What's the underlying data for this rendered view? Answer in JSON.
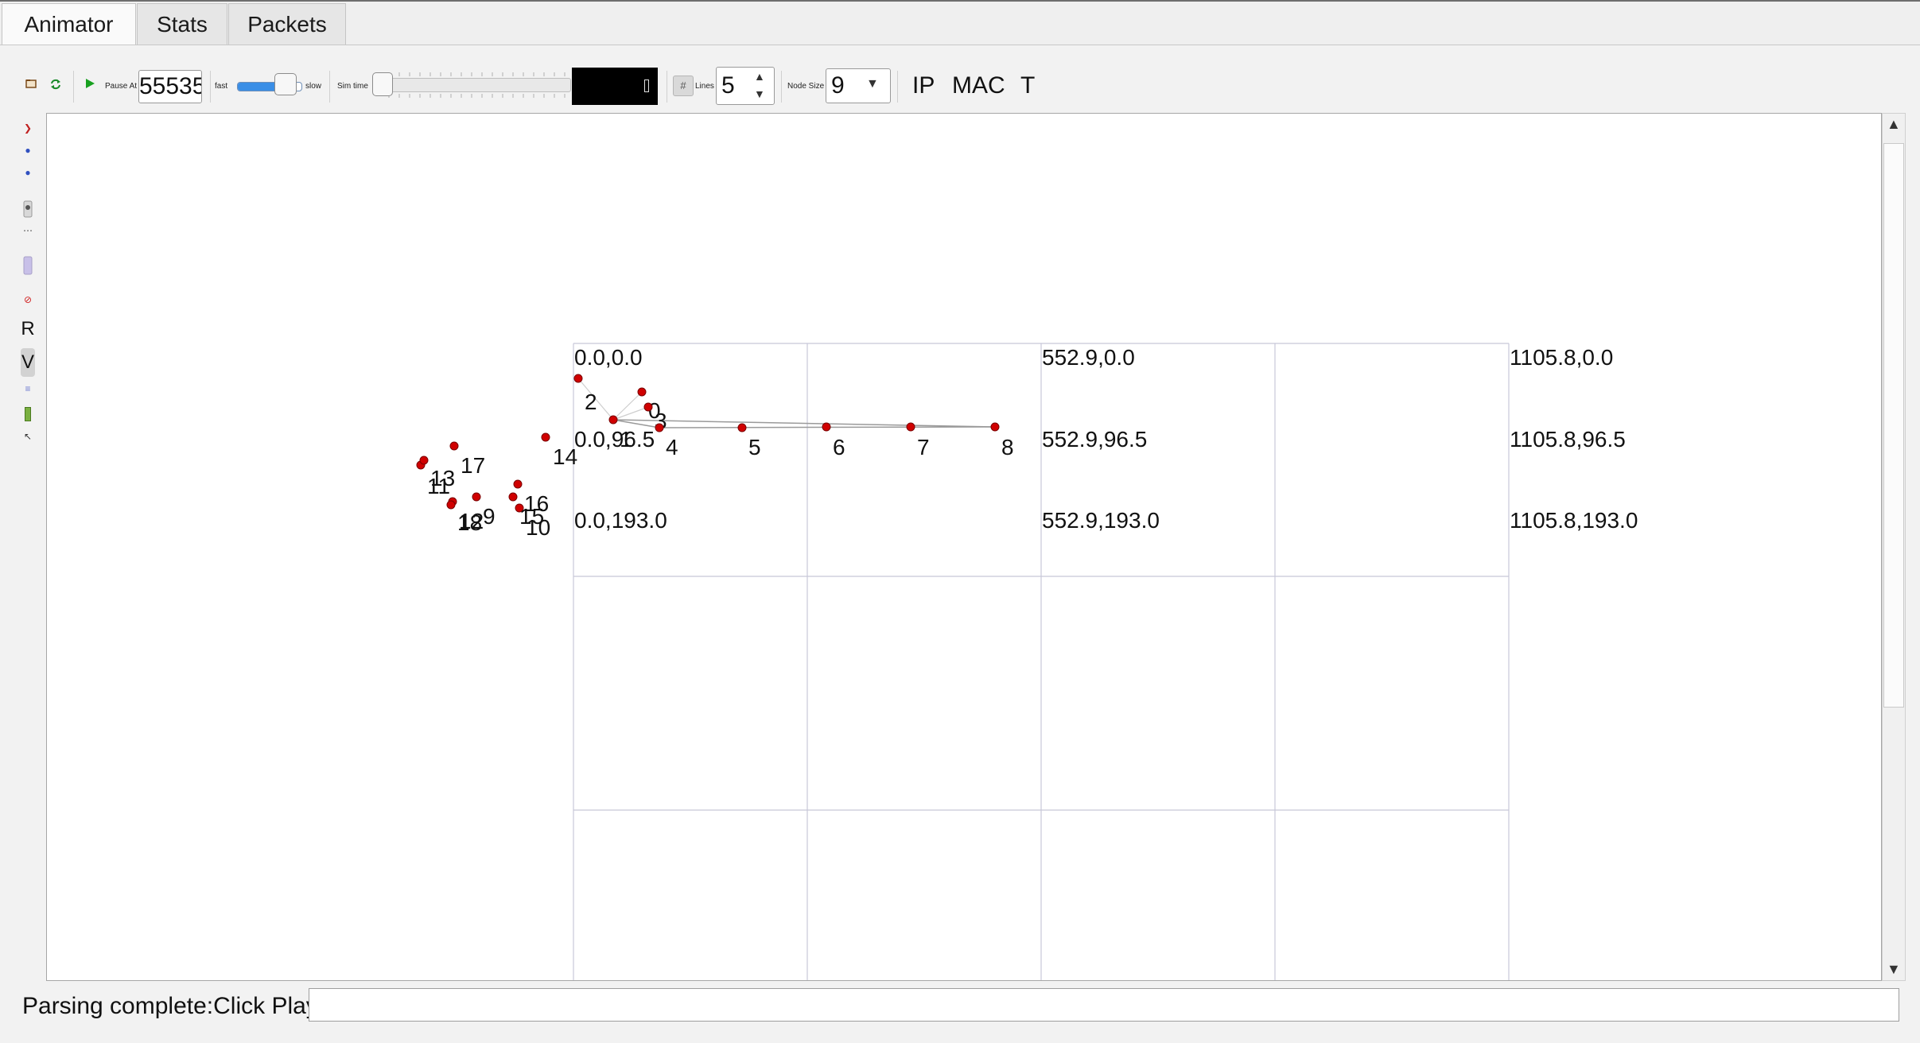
{
  "tabs": [
    {
      "label": "Animator",
      "active": true
    },
    {
      "label": "Stats",
      "active": false
    },
    {
      "label": "Packets",
      "active": false
    }
  ],
  "toolbar": {
    "open_icon": "folder-open-icon",
    "reload_icon": "reload-icon",
    "play_icon": "play-icon",
    "pause_at_label": "Pause At",
    "pause_at_value": "55535",
    "fast_label": "fast",
    "slow_label": "slow",
    "speed_level": 0.6,
    "sim_time_label": "Sim time",
    "sim_time_level": 0.0,
    "grid_icon": "grid-icon",
    "lines_label": "Lines",
    "lines_value": "5",
    "node_size_label": "Node Size",
    "node_size_value": "9",
    "ip_toggle": "IP",
    "mac_toggle": "MAC",
    "t_toggle": "T"
  },
  "left_toolbar": {
    "icons": [
      "arrow-right-icon",
      "zoom-in-icon",
      "zoom-out-icon",
      "node-icon",
      "link-icon",
      "snapshot-icon",
      "no-entry-icon",
      "r-button",
      "v-button",
      "list-icon",
      "battery-icon",
      "cursor-icon"
    ],
    "r_label": "R",
    "v_label": "V"
  },
  "canvas": {
    "grid_labels": [
      "0.0,0.0",
      "552.9,0.0",
      "1105.8,0.0",
      "0.0,96.5",
      "552.9,96.5",
      "1105.8,96.5",
      "0.0,193.0",
      "552.9,193.0",
      "1105.8,193.0"
    ],
    "node_color": "#d00000",
    "nodes": [
      {
        "id": "0"
      },
      {
        "id": "1"
      },
      {
        "id": "2"
      },
      {
        "id": "3"
      },
      {
        "id": "4"
      },
      {
        "id": "5"
      },
      {
        "id": "6"
      },
      {
        "id": "7"
      },
      {
        "id": "8"
      },
      {
        "id": "9"
      },
      {
        "id": "10"
      },
      {
        "id": "11"
      },
      {
        "id": "12"
      },
      {
        "id": "13"
      },
      {
        "id": "14"
      },
      {
        "id": "15"
      },
      {
        "id": "16"
      },
      {
        "id": "17"
      },
      {
        "id": "18"
      }
    ]
  },
  "status": {
    "text": "Parsing complete:Click Play",
    "field_value": ""
  }
}
